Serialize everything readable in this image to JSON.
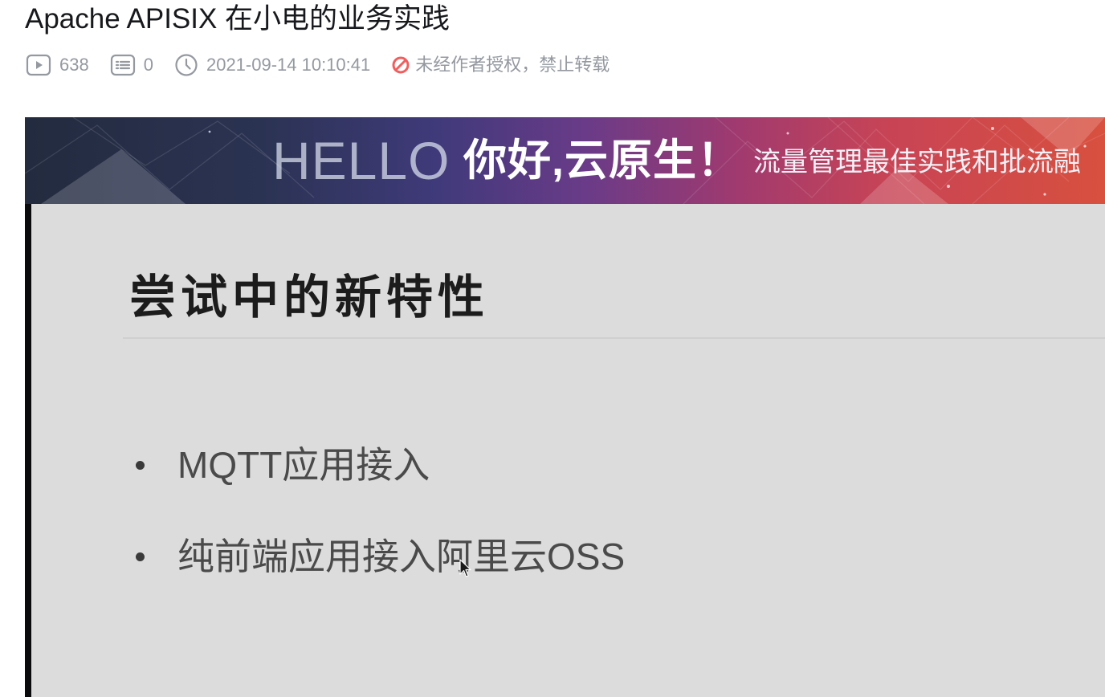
{
  "video": {
    "title": "Apache APISIX 在小电的业务实践"
  },
  "meta": {
    "play_icon": "play-icon",
    "play_count": "638",
    "danmaku_icon": "danmaku-icon",
    "danmaku_count": "0",
    "clock_icon": "clock-icon",
    "publish_time": "2021-09-14 10:10:41",
    "forbid_icon": "forbid-icon",
    "copyright_notice": "未经作者授权，禁止转载",
    "forbid_color": "#f25d5d"
  },
  "slide": {
    "banner": {
      "hello": "HELLO",
      "main": "你好,云原生！",
      "subtitle": "流量管理最佳实践和批流融"
    },
    "heading": "尝试中的新特性",
    "bullets": [
      "MQTT应用接入",
      "纯前端应用接入阿里云OSS"
    ]
  }
}
